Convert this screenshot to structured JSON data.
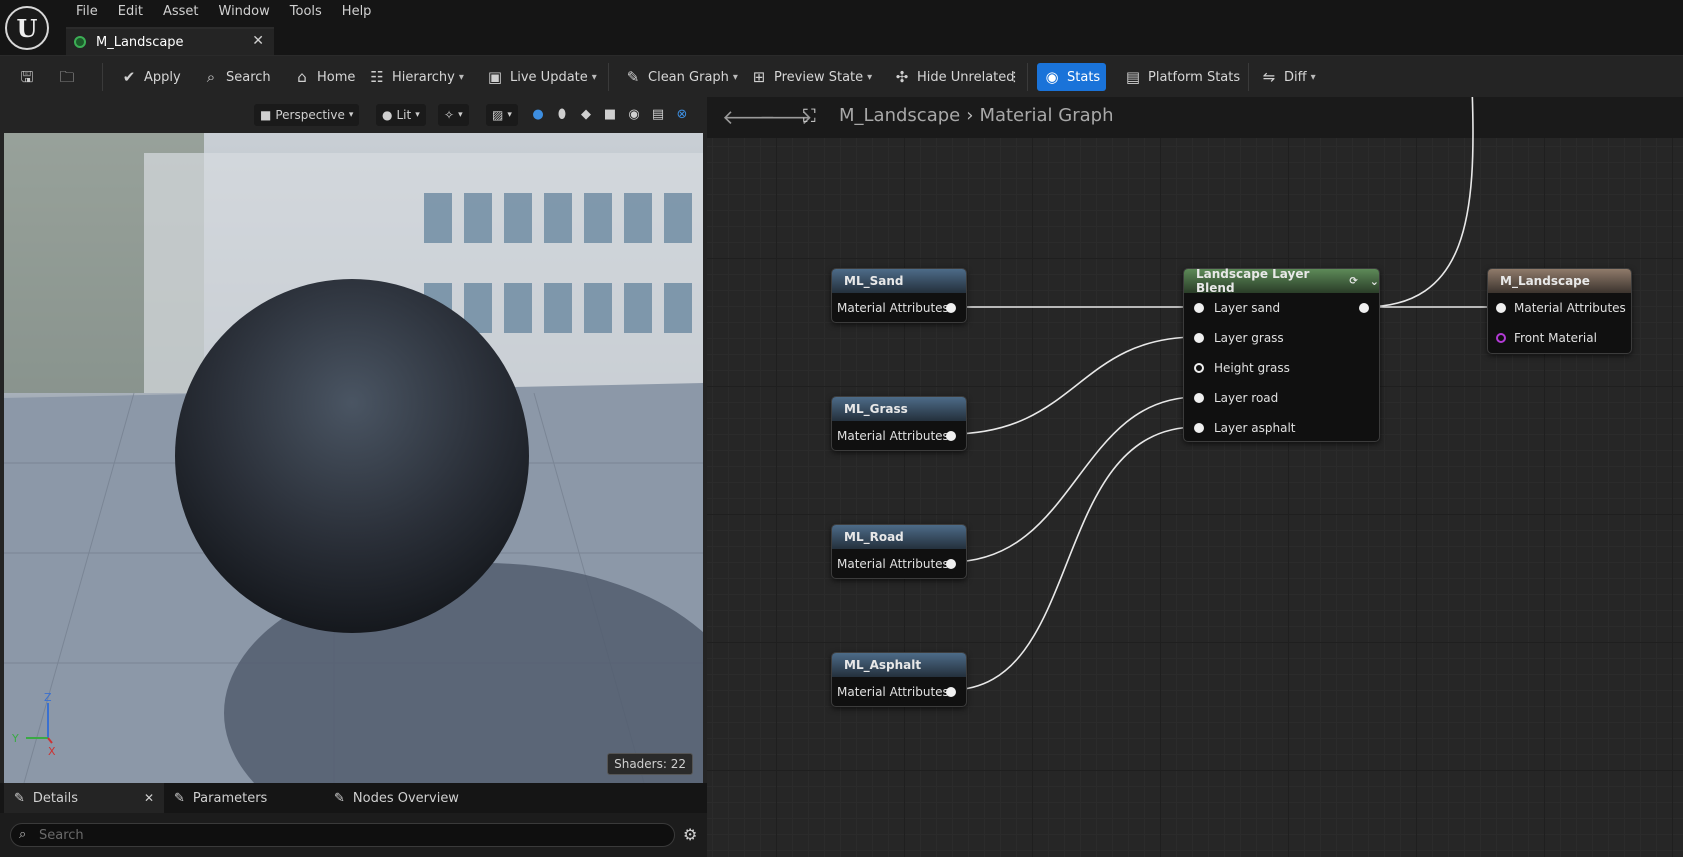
{
  "menu": [
    "File",
    "Edit",
    "Asset",
    "Window",
    "Tools",
    "Help"
  ],
  "tab": {
    "title": "M_Landscape"
  },
  "toolbar": {
    "apply": "Apply",
    "search": "Search",
    "home": "Home",
    "hierarchy": "Hierarchy",
    "live_update": "Live Update",
    "clean_graph": "Clean Graph",
    "preview_state": "Preview State",
    "hide_unrelated": "Hide Unrelated",
    "stats": "Stats",
    "platform_stats": "Platform Stats",
    "diff": "Diff"
  },
  "viewport": {
    "perspective": "Perspective",
    "lit": "Lit",
    "shaders": "Shaders: 22",
    "axis_z": "Z",
    "axis_y": "Y",
    "axis_x": "X"
  },
  "details": {
    "tabs": [
      "Details",
      "Parameters",
      "Nodes Overview"
    ],
    "search_placeholder": "Search"
  },
  "graph": {
    "breadcrumb": [
      "M_Landscape",
      "Material Graph"
    ],
    "nodes": {
      "sand": {
        "title": "ML_Sand",
        "pin": "Material Attributes"
      },
      "grass": {
        "title": "ML_Grass",
        "pin": "Material Attributes"
      },
      "road": {
        "title": "ML_Road",
        "pin": "Material Attributes"
      },
      "asphalt": {
        "title": "ML_Asphalt",
        "pin": "Material Attributes"
      },
      "blend": {
        "title": "Landscape Layer Blend",
        "pins": [
          "Layer sand",
          "Layer grass",
          "Height grass",
          "Layer road",
          "Layer asphalt"
        ]
      },
      "result": {
        "title": "M_Landscape",
        "pins": [
          "Material Attributes",
          "Front Material"
        ]
      }
    }
  },
  "colors": {
    "accent": "#1a73d9",
    "function_node": "#4d6b88",
    "blend_node": "#5d8a58",
    "result_node": "#8f7a6a",
    "front_material_pin": "#b33bd6"
  }
}
